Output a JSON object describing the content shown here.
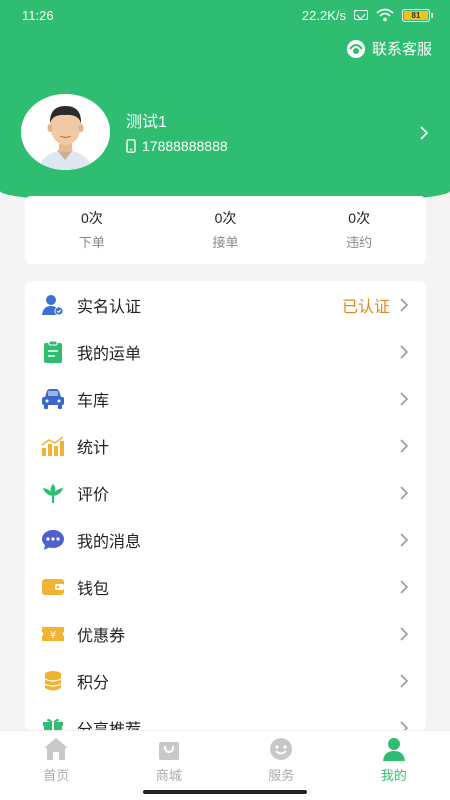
{
  "status_bar": {
    "time": "11:26",
    "network": "22.2K/s",
    "battery": "81"
  },
  "header": {
    "service_label": "联系客服",
    "name": "测试1",
    "phone": "17888888888"
  },
  "stats": [
    {
      "value": "0次",
      "label": "下单"
    },
    {
      "value": "0次",
      "label": "接单"
    },
    {
      "value": "0次",
      "label": "违约"
    }
  ],
  "menu": [
    {
      "label": "实名认证",
      "status": "已认证",
      "icon": "verified-user-icon",
      "color": "#3b6fd6"
    },
    {
      "label": "我的运单",
      "status": "",
      "icon": "clipboard-icon",
      "color": "#2fbd71"
    },
    {
      "label": "车库",
      "status": "",
      "icon": "car-icon",
      "color": "#3a67c9"
    },
    {
      "label": "统计",
      "status": "",
      "icon": "chart-icon",
      "color": "#f2b233"
    },
    {
      "label": "评价",
      "status": "",
      "icon": "lotus-icon",
      "color": "#2fbd71"
    },
    {
      "label": "我的消息",
      "status": "",
      "icon": "chat-icon",
      "color": "#4f5fd0"
    },
    {
      "label": "钱包",
      "status": "",
      "icon": "wallet-icon",
      "color": "#f2b233"
    },
    {
      "label": "优惠券",
      "status": "",
      "icon": "coupon-icon",
      "color": "#f2b233"
    },
    {
      "label": "积分",
      "status": "",
      "icon": "coins-icon",
      "color": "#f2b233"
    },
    {
      "label": "分享推荐",
      "status": "",
      "icon": "gift-icon",
      "color": "#2fbd71"
    }
  ],
  "tabs": [
    {
      "label": "首页",
      "icon": "home-icon",
      "active": false
    },
    {
      "label": "商城",
      "icon": "shopping-bag-icon",
      "active": false
    },
    {
      "label": "服务",
      "icon": "smile-icon",
      "active": false
    },
    {
      "label": "我的",
      "icon": "person-icon",
      "active": true
    }
  ],
  "colors": {
    "brand": "#2fbd71",
    "accent": "#e08a1e",
    "inactive": "#aaaaaa"
  }
}
